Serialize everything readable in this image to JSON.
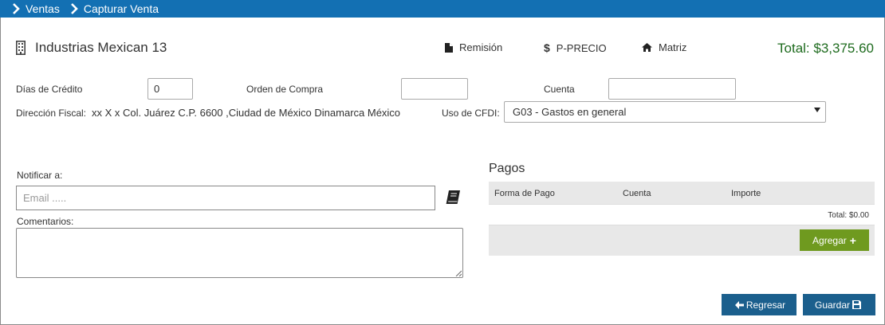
{
  "breadcrumb": {
    "items": [
      "Ventas",
      "Capturar Venta"
    ]
  },
  "header": {
    "company": "Industrias Mexican 13",
    "remision_label": "Remisión",
    "pprecio_symbol": "$",
    "pprecio_label": "P-PRECIO",
    "matriz_label": "Matriz",
    "total": "Total: $3,375.60"
  },
  "form": {
    "dias_credito_label": "Días de Crédito",
    "dias_credito_value": "0",
    "orden_compra_label": "Orden de Compra",
    "orden_compra_value": "",
    "cuenta_label": "Cuenta",
    "cuenta_value": "",
    "direccion_label": "Dirección Fiscal:",
    "direccion_value": "xx X x Col. Juárez C.P. 6600 ,Ciudad de México Dinamarca México",
    "uso_cfdi_label": "Uso de CFDI:",
    "uso_cfdi_value": "G03 - Gastos en general"
  },
  "notify": {
    "label": "Notificar a:",
    "email_placeholder": "Email .....",
    "comments_label": "Comentarios:"
  },
  "pagos": {
    "title": "Pagos",
    "columns": [
      "Forma de Pago",
      "Cuenta",
      "Importe"
    ],
    "total": "Total: $0.00",
    "add_label": "Agregar"
  },
  "actions": {
    "back_label": "Regresar",
    "save_label": "Guardar"
  },
  "colors": {
    "topbar": "#1370b3",
    "total": "#1e6b1e",
    "add": "#6f9a1f",
    "button": "#1b5f8d"
  }
}
